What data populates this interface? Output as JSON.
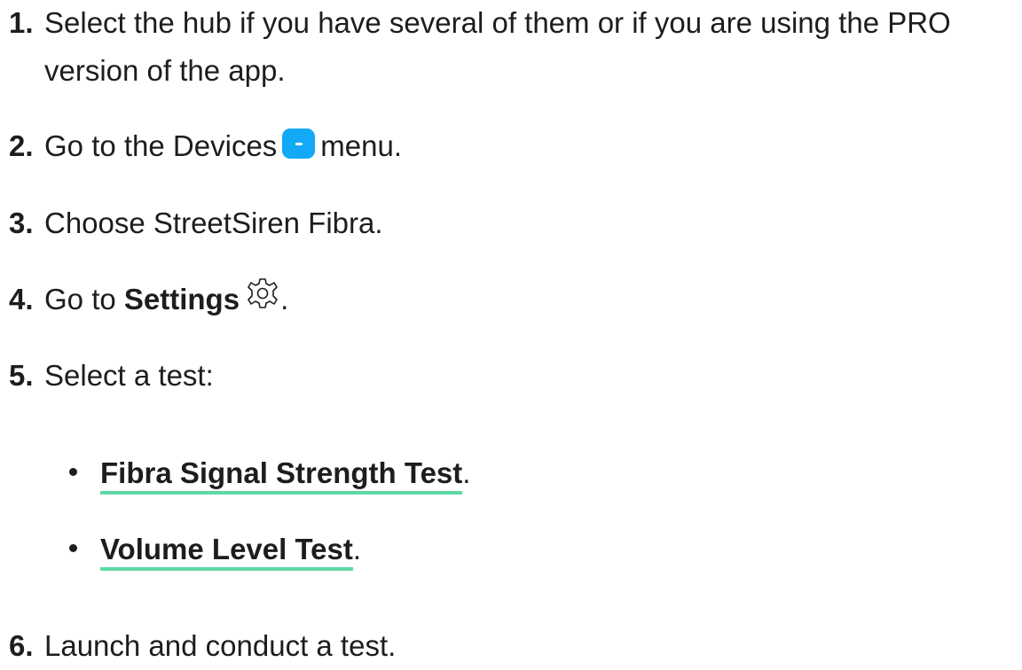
{
  "steps": [
    {
      "num": "1.",
      "text": "Select the hub if you have several of them or if you are using the PRO",
      "text_cont": "version of the app."
    },
    {
      "num": "2.",
      "text_before": "Go to the Devices",
      "icon": "devices-icon",
      "text_after": "menu."
    },
    {
      "num": "3.",
      "text": "Choose StreetSiren Fibra."
    },
    {
      "num": "4.",
      "text_before": "Go to ",
      "strong": "Settings",
      "icon": "gear-icon",
      "text_after": "."
    },
    {
      "num": "5.",
      "text": "Select a test:"
    },
    {
      "num": "6.",
      "text": "Launch and conduct a test."
    }
  ],
  "tests": [
    {
      "label": "Fibra Signal Strength Test",
      "suffix": "."
    },
    {
      "label": "Volume Level Test",
      "suffix": "."
    }
  ],
  "colors": {
    "text": "#1d1d1f",
    "devices_icon": "#13a9f7",
    "link_underline": "#5ed9a6"
  }
}
